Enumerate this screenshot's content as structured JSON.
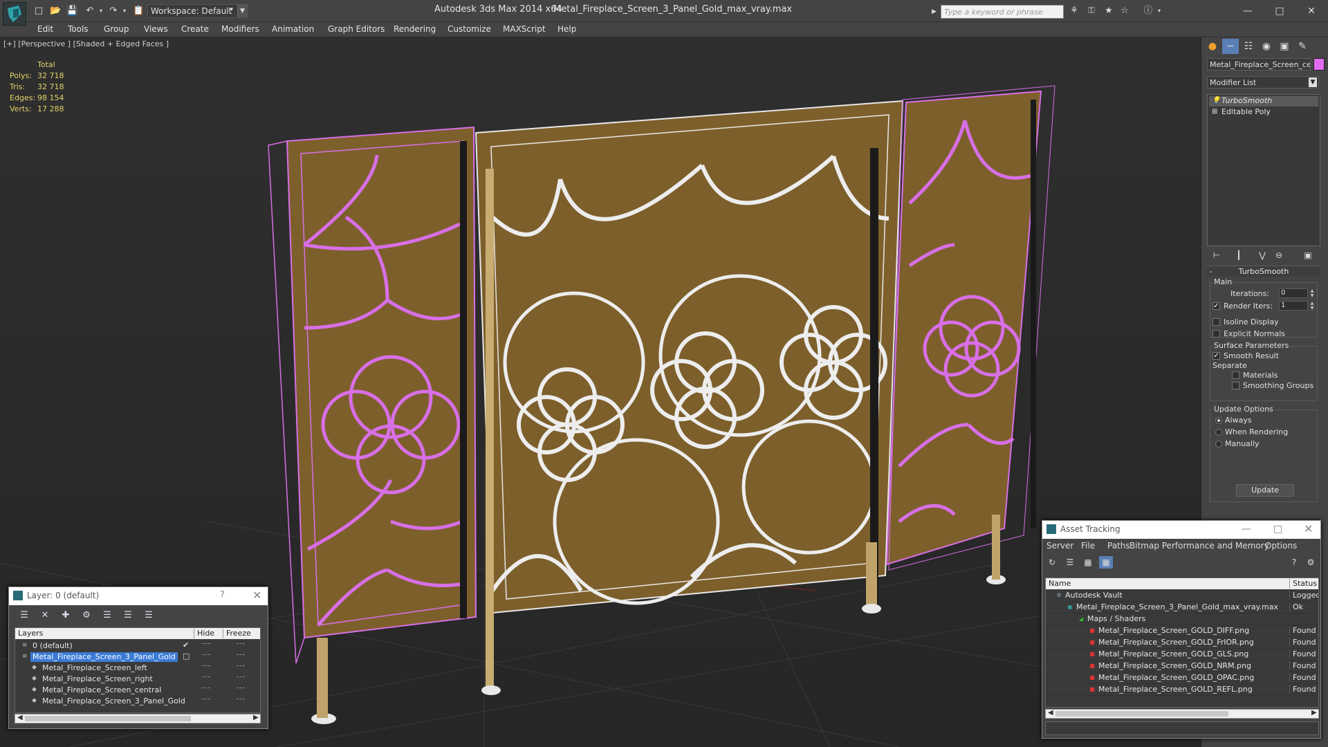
{
  "titlebar": {
    "workspace": "Workspace: Default",
    "app_title": "Autodesk 3ds Max  2014 x64",
    "file_title": "Metal_Fireplace_Screen_3_Panel_Gold_max_vray.max",
    "search_placeholder": "Type a keyword or phrase"
  },
  "menu": [
    "Edit",
    "Tools",
    "Group",
    "Views",
    "Create",
    "Modifiers",
    "Animation",
    "Graph Editors",
    "Rendering",
    "Customize",
    "MAXScript",
    "Help"
  ],
  "viewport": {
    "label": "[+] [Perspective ] [Shaded + Edged Faces ]",
    "stats": {
      "header": "Total",
      "rows": [
        {
          "label": "Polys:",
          "value": "32 718"
        },
        {
          "label": "Tris:",
          "value": "32 718"
        },
        {
          "label": "Edges:",
          "value": "98 154"
        },
        {
          "label": "Verts:",
          "value": "17 288"
        }
      ]
    },
    "colors": {
      "panel_fill": "#7d5f2c",
      "selected_wire": "#d86fe6",
      "wire": "#e8e8e8"
    }
  },
  "command_panel": {
    "object_name": "Metal_Fireplace_Screen_cent",
    "object_color": "#e36bf0",
    "modifier_list": "Modifier List",
    "stack": [
      "TurboSmooth",
      "Editable Poly"
    ],
    "turbosmooth": {
      "title": "TurboSmooth",
      "main_group": "Main",
      "iterations_label": "Iterations:",
      "iterations_value": "0",
      "render_iters_label": "Render Iters:",
      "render_iters_value": "1",
      "isoline_display": "Isoline Display",
      "explicit_normals": "Explicit Normals",
      "surface_group": "Surface Parameters",
      "smooth_result": "Smooth Result",
      "separate": "Separate",
      "materials": "Materials",
      "smoothing_groups": "Smoothing Groups",
      "update_group": "Update Options",
      "always": "Always",
      "when_rendering": "When Rendering",
      "manually": "Manually",
      "update_button": "Update"
    }
  },
  "layer_dialog": {
    "title": "Layer: 0 (default)",
    "help": "?",
    "columns": {
      "layers": "Layers",
      "hide": "Hide",
      "freeze": "Freeze"
    },
    "rows": [
      {
        "name": "0 (default)",
        "indent": 0,
        "checked": true,
        "selected": false
      },
      {
        "name": "Metal_Fireplace_Screen_3_Panel_Gold",
        "indent": 0,
        "checked": false,
        "selected": true
      },
      {
        "name": "Metal_Fireplace_Screen_left",
        "indent": 1,
        "checked": false,
        "selected": false
      },
      {
        "name": "Metal_Fireplace_Screen_right",
        "indent": 1,
        "checked": false,
        "selected": false
      },
      {
        "name": "Metal_Fireplace_Screen_central",
        "indent": 1,
        "checked": false,
        "selected": false
      },
      {
        "name": "Metal_Fireplace_Screen_3_Panel_Gold",
        "indent": 1,
        "checked": false,
        "selected": false
      }
    ]
  },
  "asset_dialog": {
    "title": "Asset Tracking",
    "menu": [
      "Server",
      "File",
      "Paths",
      "Bitmap Performance and Memory",
      "Options"
    ],
    "columns": {
      "name": "Name",
      "status": "Status"
    },
    "rows": [
      {
        "name": "Autodesk Vault",
        "status": "Logged O",
        "indent": 1,
        "icon": "vault-icon"
      },
      {
        "name": "Metal_Fireplace_Screen_3_Panel_Gold_max_vray.max",
        "status": "Ok",
        "indent": 2,
        "icon": "max-file-icon"
      },
      {
        "name": "Maps / Shaders",
        "status": "",
        "indent": 3,
        "icon": "maps-folder-icon"
      },
      {
        "name": "Metal_Fireplace_Screen_GOLD_DIFF.png",
        "status": "Found",
        "indent": 4,
        "icon": "png-icon"
      },
      {
        "name": "Metal_Fireplace_Screen_GOLD_FrIOR.png",
        "status": "Found",
        "indent": 4,
        "icon": "png-icon"
      },
      {
        "name": "Metal_Fireplace_Screen_GOLD_GLS.png",
        "status": "Found",
        "indent": 4,
        "icon": "png-icon"
      },
      {
        "name": "Metal_Fireplace_Screen_GOLD_NRM.png",
        "status": "Found",
        "indent": 4,
        "icon": "png-icon"
      },
      {
        "name": "Metal_Fireplace_Screen_GOLD_OPAC.png",
        "status": "Found",
        "indent": 4,
        "icon": "png-icon"
      },
      {
        "name": "Metal_Fireplace_Screen_GOLD_REFL.png",
        "status": "Found",
        "indent": 4,
        "icon": "png-icon"
      }
    ]
  }
}
